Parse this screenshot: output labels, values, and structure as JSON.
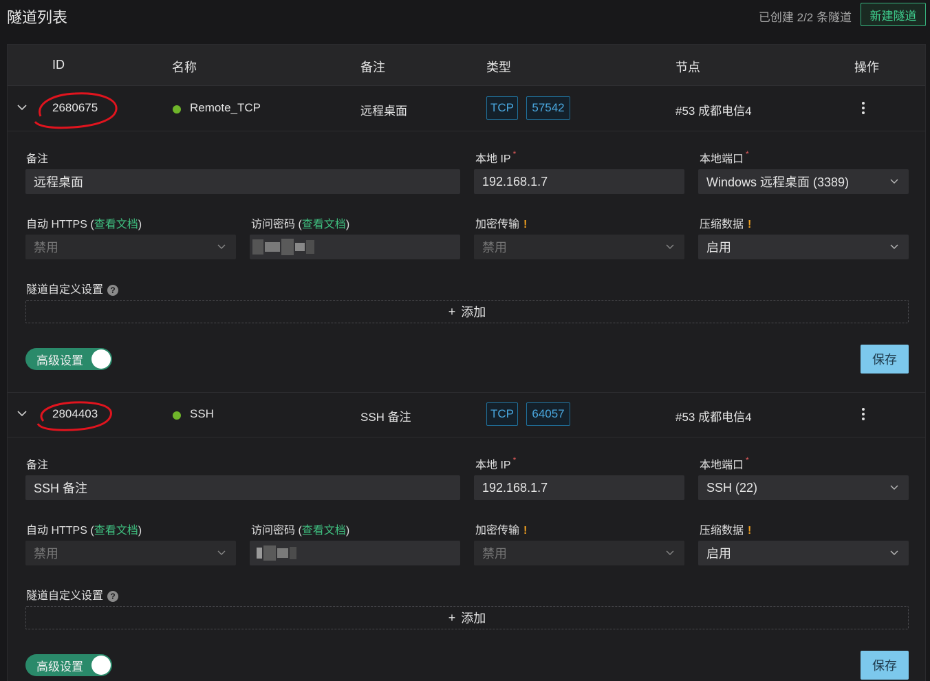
{
  "header": {
    "title": "隧道列表",
    "count_text": "已创建 2/2 条隧道",
    "new_button": "新建隧道"
  },
  "columns": [
    "ID",
    "名称",
    "备注",
    "类型",
    "节点",
    "操作"
  ],
  "tunnels": [
    {
      "id": "2680675",
      "name": "Remote_TCP",
      "note": "远程桌面",
      "protocol": "TCP",
      "remote_port": "57542",
      "node": "#53 成都电信4",
      "status_color": "#6fb52a",
      "detail": {
        "note_label": "备注",
        "note_value": "远程桌面",
        "local_ip_label": "本地 IP",
        "local_ip_value": "192.168.1.7",
        "local_port_label": "本地端口",
        "local_port_value": "Windows 远程桌面 (3389)",
        "auto_https_label": "自动 HTTPS",
        "auto_https_value": "禁用",
        "access_pw_label": "访问密码",
        "doc_link": "查看文档",
        "encrypt_label": "加密传输",
        "encrypt_value": "禁用",
        "compress_label": "压缩数据",
        "compress_value": "启用",
        "custom_label": "隧道自定义设置",
        "add_label": "添加",
        "advanced_label": "高级设置",
        "save_label": "保存"
      }
    },
    {
      "id": "2804403",
      "name": "SSH",
      "note": "SSH 备注",
      "protocol": "TCP",
      "remote_port": "64057",
      "node": "#53 成都电信4",
      "status_color": "#6fb52a",
      "detail": {
        "note_label": "备注",
        "note_value": "SSH 备注",
        "local_ip_label": "本地 IP",
        "local_ip_value": "192.168.1.7",
        "local_port_label": "本地端口",
        "local_port_value": "SSH (22)",
        "auto_https_label": "自动 HTTPS",
        "auto_https_value": "禁用",
        "access_pw_label": "访问密码",
        "doc_link": "查看文档",
        "encrypt_label": "加密传输",
        "encrypt_value": "禁用",
        "compress_label": "压缩数据",
        "compress_value": "启用",
        "custom_label": "隧道自定义设置",
        "add_label": "添加",
        "advanced_label": "高级设置",
        "save_label": "保存"
      }
    }
  ],
  "colors": {
    "accent": "#36b37e",
    "tag": "#4aa8e0",
    "highlight": "#e0141e",
    "save": "#7cc8ec"
  }
}
